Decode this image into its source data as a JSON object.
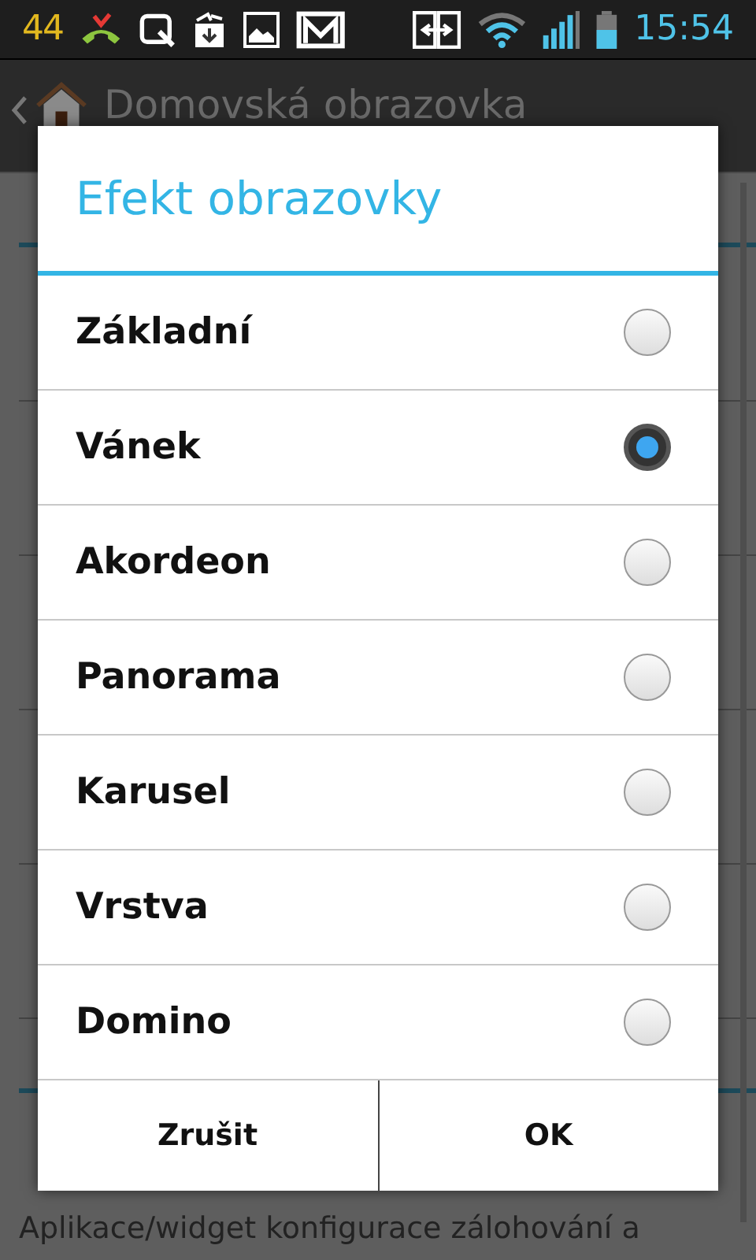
{
  "status_bar": {
    "counter": "44",
    "time": "15:54"
  },
  "action_bar": {
    "title": "Domovská obrazovka"
  },
  "background_list": [
    {
      "kind": "header"
    },
    {
      "kind": "row"
    },
    {
      "kind": "row"
    },
    {
      "kind": "row"
    },
    {
      "kind": "row"
    },
    {
      "kind": "row"
    },
    {
      "kind": "header"
    },
    {
      "kind": "row",
      "summary": "Aplikace/widget konfigurace zálohování a"
    }
  ],
  "dialog": {
    "title": "Efekt obrazovky",
    "options": [
      {
        "label": "Základní",
        "selected": false
      },
      {
        "label": "Vánek",
        "selected": true
      },
      {
        "label": "Akordeon",
        "selected": false
      },
      {
        "label": "Panorama",
        "selected": false
      },
      {
        "label": "Karusel",
        "selected": false
      },
      {
        "label": "Vrstva",
        "selected": false
      },
      {
        "label": "Domino",
        "selected": false
      }
    ],
    "buttons": [
      "Zrušit",
      "OK"
    ]
  }
}
